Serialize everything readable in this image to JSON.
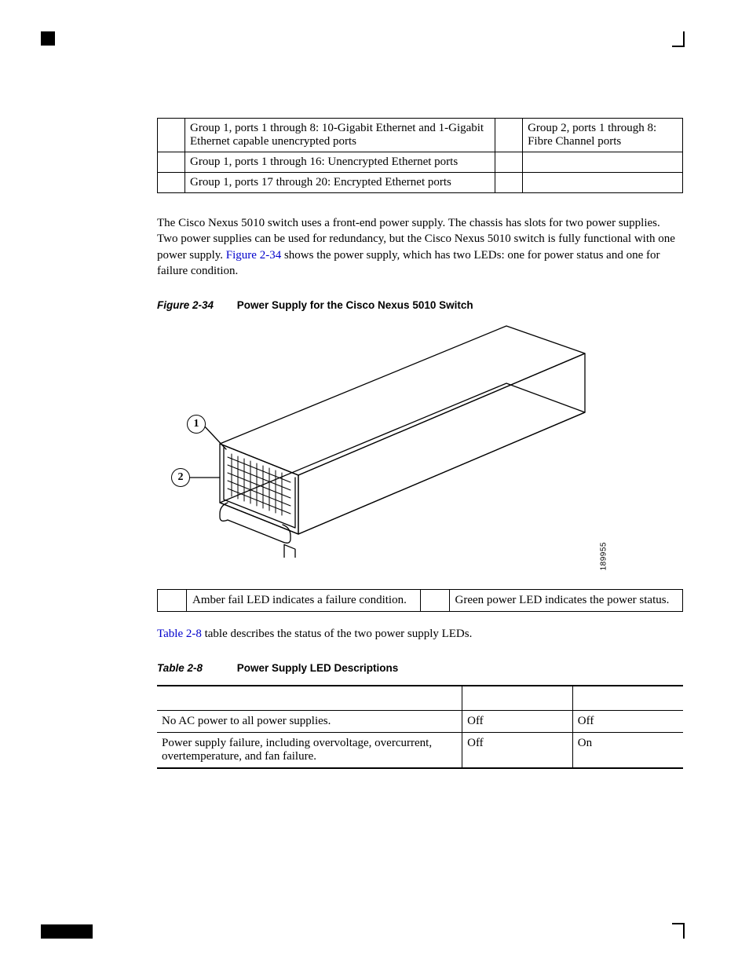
{
  "ports_table": {
    "rows": [
      {
        "l": "Group 1, ports 1 through 8: 10-Gigabit Ethernet and 1-Gigabit Ethernet capable unencrypted ports",
        "r": "Group 2, ports 1 through 8: Fibre Channel ports"
      },
      {
        "l": "Group 1, ports 1 through 16: Unencrypted Ethernet ports",
        "r": ""
      },
      {
        "l": "Group 1, ports 17 through 20: Encrypted Ethernet ports",
        "r": ""
      }
    ]
  },
  "paragraph": {
    "pre": "The Cisco Nexus 5010 switch uses a front-end power supply. The chassis has slots for two power supplies. Two power supplies can be used for redundancy, but the Cisco Nexus 5010 switch is fully functional with one power supply. ",
    "xref": "Figure 2-34",
    "post": " shows the power supply, which has two LEDs: one for power status and one for failure condition."
  },
  "figure": {
    "num": "Figure 2-34",
    "title": "Power Supply for the Cisco Nexus 5010 Switch",
    "callout1": "1",
    "callout2": "2",
    "id": "189955"
  },
  "legend": {
    "c1": "Amber fail LED indicates a failure condition.",
    "c2": "Green power LED indicates the power status."
  },
  "after_legend": {
    "xref": "Table 2-8",
    "post": " table describes the status of the two power supply LEDs."
  },
  "table28": {
    "num": "Table 2-8",
    "title": "Power Supply LED Descriptions",
    "rows": [
      {
        "desc": "No AC power to all power supplies.",
        "green": "Off",
        "amber": "Off"
      },
      {
        "desc": "Power supply failure, including overvoltage, overcurrent, overtemperature, and fan failure.",
        "green": "Off",
        "amber": "On"
      }
    ]
  }
}
